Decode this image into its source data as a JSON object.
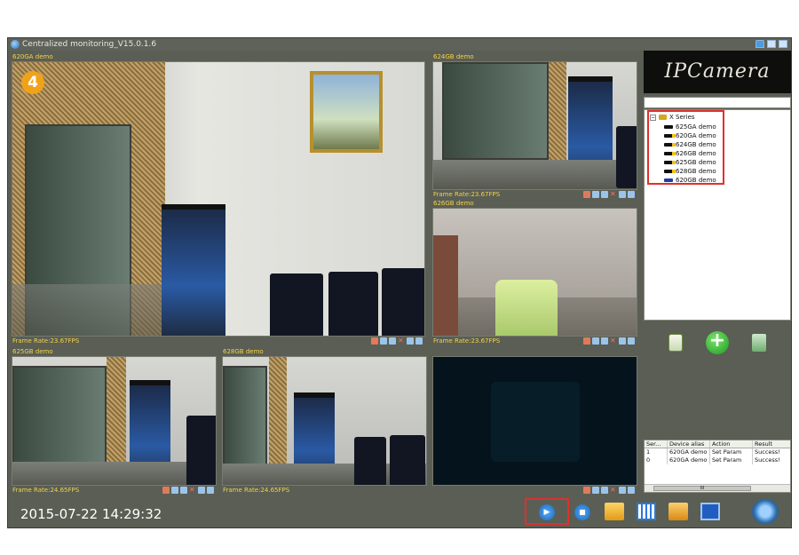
{
  "window": {
    "title": "Centralized monitoring_V15.0.1.6"
  },
  "badge_number": "4",
  "panes": {
    "p1": {
      "label": "620GA demo",
      "frame_rate": "Frame Rate:23.67FPS"
    },
    "p2": {
      "label": "624GB demo",
      "frame_rate": "Frame Rate:23.67FPS"
    },
    "p3": {
      "label": "626GB demo",
      "frame_rate": "Frame Rate:23.67FPS"
    },
    "p4": {
      "label": "625GB demo",
      "frame_rate": "Frame Rate:24.65FPS"
    },
    "p5": {
      "label": "628GB demo",
      "frame_rate": "Frame Rate:24.65FPS"
    },
    "p6": {
      "label": "",
      "frame_rate": ""
    }
  },
  "logo": {
    "text": "IPCamera"
  },
  "device_tree": {
    "root": "X Series",
    "items": [
      {
        "name": "625GA demo",
        "icon": "camera-black"
      },
      {
        "name": "620GA demo",
        "icon": "camera-yellow"
      },
      {
        "name": "624GB demo",
        "icon": "camera-yellow"
      },
      {
        "name": "626GB demo",
        "icon": "camera-yellow"
      },
      {
        "name": "625GB demo",
        "icon": "camera-yellow"
      },
      {
        "name": "628GB demo",
        "icon": "camera-yellow"
      },
      {
        "name": "620GB demo",
        "icon": "camera-blue"
      }
    ]
  },
  "log": {
    "headers": [
      "Ser...",
      "Device alias",
      "Action",
      "Result"
    ],
    "rows": [
      [
        "1",
        "620GA demo",
        "Set Param",
        "Success!"
      ],
      [
        "0",
        "620GA demo",
        "Set Param",
        "Success!"
      ]
    ],
    "scroll_label": "III"
  },
  "statusbar": {
    "datetime": "2015-07-22 14:29:32"
  },
  "colors": {
    "highlight": "#e0302b",
    "label_yellow": "#f4d34a",
    "frame_bg": "#5a5e54"
  }
}
